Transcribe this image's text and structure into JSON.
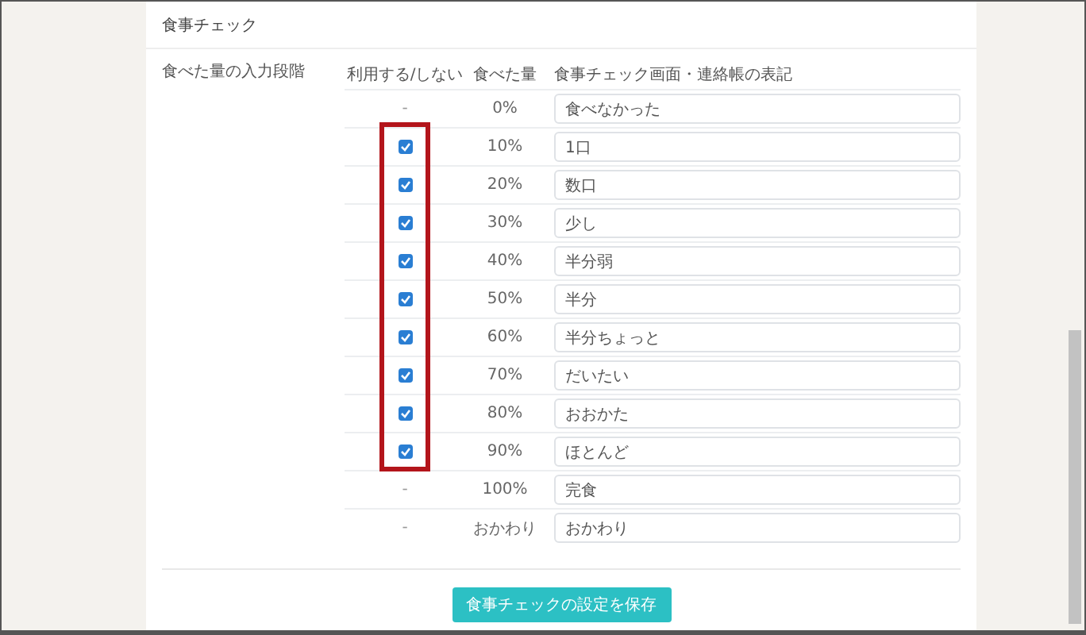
{
  "section_title": "食事チェック",
  "field_label": "食べた量の入力段階",
  "table": {
    "columns": [
      "利用する/しない",
      "食べた量",
      "食事チェック画面・連絡帳の表記"
    ],
    "highlight_checkbox_column": true,
    "rows": [
      {
        "kind": "fixed",
        "use": "-",
        "amount": "0%",
        "label": "食べなかった"
      },
      {
        "kind": "checkbox",
        "checked": true,
        "amount": "10%",
        "label": "1口"
      },
      {
        "kind": "checkbox",
        "checked": true,
        "amount": "20%",
        "label": "数口"
      },
      {
        "kind": "checkbox",
        "checked": true,
        "amount": "30%",
        "label": "少し"
      },
      {
        "kind": "checkbox",
        "checked": true,
        "amount": "40%",
        "label": "半分弱"
      },
      {
        "kind": "checkbox",
        "checked": true,
        "amount": "50%",
        "label": "半分"
      },
      {
        "kind": "checkbox",
        "checked": true,
        "amount": "60%",
        "label": "半分ちょっと"
      },
      {
        "kind": "checkbox",
        "checked": true,
        "amount": "70%",
        "label": "だいたい"
      },
      {
        "kind": "checkbox",
        "checked": true,
        "amount": "80%",
        "label": "おおかた"
      },
      {
        "kind": "checkbox",
        "checked": true,
        "amount": "90%",
        "label": "ほとんど"
      },
      {
        "kind": "fixed",
        "use": "-",
        "amount": "100%",
        "label": "完食"
      },
      {
        "kind": "fixed",
        "use": "-",
        "amount": "おかわり",
        "label": "おかわり"
      }
    ]
  },
  "save_button": "食事チェックの設定を保存"
}
